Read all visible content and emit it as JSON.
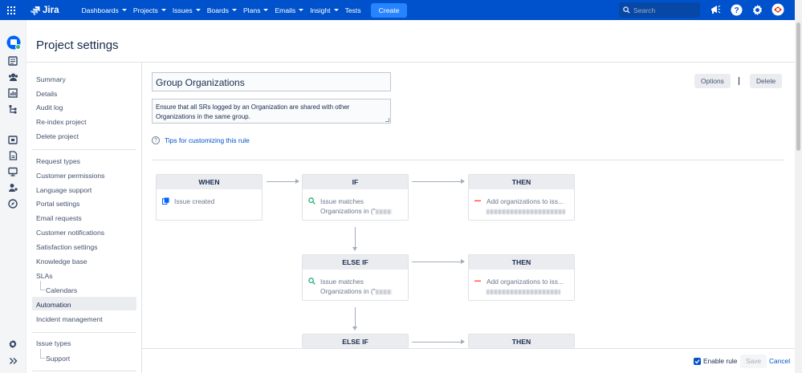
{
  "topbar": {
    "product": "Jira",
    "nav": [
      "Dashboards",
      "Projects",
      "Issues",
      "Boards",
      "Plans",
      "Emails",
      "Insight"
    ],
    "tests": "Tests",
    "create": "Create",
    "search_placeholder": "Search"
  },
  "page": {
    "title": "Project settings"
  },
  "sidebar": {
    "group1": [
      "Summary",
      "Details",
      "Audit log",
      "Re-index project",
      "Delete project"
    ],
    "group2": [
      "Request types",
      "Customer permissions",
      "Language support",
      "Portal settings",
      "Email requests",
      "Customer notifications",
      "Satisfaction settings",
      "Knowledge base",
      "SLAs"
    ],
    "sla_sub": "Calendars",
    "active": "Automation",
    "after_active": "Incident management",
    "group3": "Issue types",
    "issue_sub": "Support"
  },
  "rule": {
    "name": "Group Organizations",
    "description": "Ensure that all SRs logged by an Organization are shared with other Organizations in the same group.",
    "tips": "Tips for customizing this rule",
    "options": "Options",
    "delete": "Delete"
  },
  "flow": {
    "when": {
      "head": "WHEN",
      "text": "Issue created"
    },
    "if": {
      "head": "IF",
      "line1": "Issue matches",
      "line2": "Organizations in (\""
    },
    "then1": {
      "head": "THEN",
      "line1": "Add organizations to iss..."
    },
    "elseif1": {
      "head": "ELSE IF",
      "line1": "Issue matches",
      "line2": "Organizations in (\""
    },
    "then2": {
      "head": "THEN",
      "line1": "Add organizations to iss..."
    },
    "elseif2": {
      "head": "ELSE IF"
    },
    "then3": {
      "head": "THEN"
    }
  },
  "footer": {
    "enable": "Enable rule",
    "save": "Save",
    "cancel": "Cancel"
  },
  "colors": {
    "brand": "#0052cc",
    "create": "#2684ff",
    "search_match": "#36b37e",
    "action": "#ff5630"
  }
}
